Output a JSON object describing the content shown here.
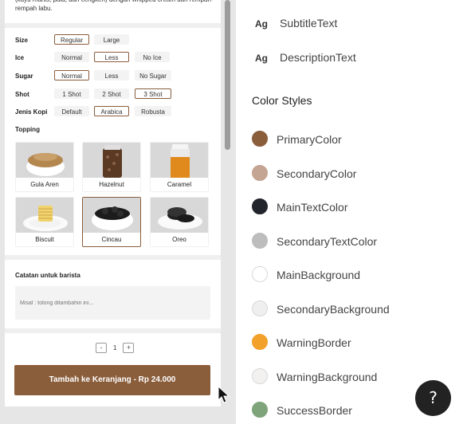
{
  "product": {
    "description": "(kayu manis, pala, dan cengkeh) dengan whipped cream dan rempah-rempah labu."
  },
  "options": [
    {
      "label": "Size",
      "choices": [
        "Regular",
        "Large"
      ],
      "selected": "Regular"
    },
    {
      "label": "Ice",
      "choices": [
        "Normal",
        "Less",
        "No Ice"
      ],
      "selected": "Less"
    },
    {
      "label": "Sugar",
      "choices": [
        "Normal",
        "Less",
        "No Sugar"
      ],
      "selected": "Normal"
    },
    {
      "label": "Shot",
      "choices": [
        "1 Shot",
        "2 Shot",
        "3 Shot"
      ],
      "selected": "3 Shot"
    },
    {
      "label": "Jenis Kopi",
      "choices": [
        "Default",
        "Arabica",
        "Robusta"
      ],
      "selected": "Arabica"
    }
  ],
  "topping": {
    "title": "Topping",
    "items": [
      {
        "label": "Gula Aren",
        "icon": "palm-sugar-bowl-image"
      },
      {
        "label": "Hazelnut",
        "icon": "hazelnut-jar-image"
      },
      {
        "label": "Caramel",
        "icon": "caramel-jar-image"
      },
      {
        "label": "Biscuit",
        "icon": "biscuit-plate-image"
      },
      {
        "label": "Cincau",
        "icon": "cincau-bowl-image"
      },
      {
        "label": "Oreo",
        "icon": "oreo-plate-image"
      }
    ],
    "selected": "Cincau"
  },
  "notes": {
    "title": "Catatan untuk barista",
    "placeholder": "Misal : tolong ditambahin ini...",
    "value": ""
  },
  "quantity": {
    "minus": "-",
    "value": "1",
    "plus": "+"
  },
  "cart_button": "Tambah ke Keranjang - Rp 24.000",
  "text_styles": [
    {
      "ag": "Ag",
      "name": "SubtitleText"
    },
    {
      "ag": "Ag",
      "name": "DescriptionText"
    }
  ],
  "color_styles": {
    "title": "Color Styles",
    "items": [
      {
        "name": "PrimaryColor",
        "color": "#8a5d3b"
      },
      {
        "name": "SecondaryColor",
        "color": "#c4a593"
      },
      {
        "name": "MainTextColor",
        "color": "#22252b"
      },
      {
        "name": "SecondaryTextColor",
        "color": "#bdbdbd"
      },
      {
        "name": "MainBackground",
        "color": "#ffffff"
      },
      {
        "name": "SecondaryBackground",
        "color": "#efefef"
      },
      {
        "name": "WarningBorder",
        "color": "#f2a12a"
      },
      {
        "name": "WarningBackground",
        "color": "#f2f1ef"
      },
      {
        "name": "SuccessBorder",
        "color": "#7fa37a"
      }
    ]
  },
  "help_button": "?"
}
